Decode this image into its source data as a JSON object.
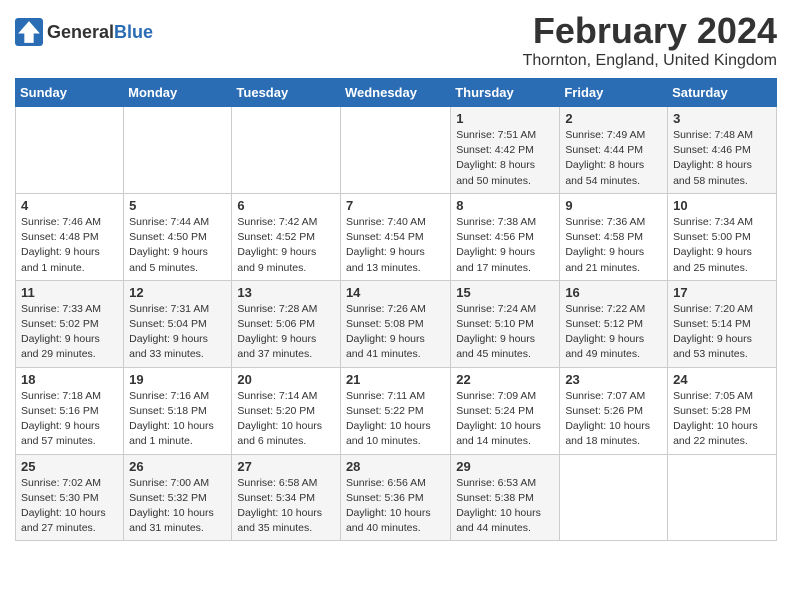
{
  "header": {
    "logo_line1": "General",
    "logo_line2": "Blue",
    "month_title": "February 2024",
    "location": "Thornton, England, United Kingdom"
  },
  "days_of_week": [
    "Sunday",
    "Monday",
    "Tuesday",
    "Wednesday",
    "Thursday",
    "Friday",
    "Saturday"
  ],
  "weeks": [
    [
      {
        "day": "",
        "info": ""
      },
      {
        "day": "",
        "info": ""
      },
      {
        "day": "",
        "info": ""
      },
      {
        "day": "",
        "info": ""
      },
      {
        "day": "1",
        "info": "Sunrise: 7:51 AM\nSunset: 4:42 PM\nDaylight: 8 hours\nand 50 minutes."
      },
      {
        "day": "2",
        "info": "Sunrise: 7:49 AM\nSunset: 4:44 PM\nDaylight: 8 hours\nand 54 minutes."
      },
      {
        "day": "3",
        "info": "Sunrise: 7:48 AM\nSunset: 4:46 PM\nDaylight: 8 hours\nand 58 minutes."
      }
    ],
    [
      {
        "day": "4",
        "info": "Sunrise: 7:46 AM\nSunset: 4:48 PM\nDaylight: 9 hours\nand 1 minute."
      },
      {
        "day": "5",
        "info": "Sunrise: 7:44 AM\nSunset: 4:50 PM\nDaylight: 9 hours\nand 5 minutes."
      },
      {
        "day": "6",
        "info": "Sunrise: 7:42 AM\nSunset: 4:52 PM\nDaylight: 9 hours\nand 9 minutes."
      },
      {
        "day": "7",
        "info": "Sunrise: 7:40 AM\nSunset: 4:54 PM\nDaylight: 9 hours\nand 13 minutes."
      },
      {
        "day": "8",
        "info": "Sunrise: 7:38 AM\nSunset: 4:56 PM\nDaylight: 9 hours\nand 17 minutes."
      },
      {
        "day": "9",
        "info": "Sunrise: 7:36 AM\nSunset: 4:58 PM\nDaylight: 9 hours\nand 21 minutes."
      },
      {
        "day": "10",
        "info": "Sunrise: 7:34 AM\nSunset: 5:00 PM\nDaylight: 9 hours\nand 25 minutes."
      }
    ],
    [
      {
        "day": "11",
        "info": "Sunrise: 7:33 AM\nSunset: 5:02 PM\nDaylight: 9 hours\nand 29 minutes."
      },
      {
        "day": "12",
        "info": "Sunrise: 7:31 AM\nSunset: 5:04 PM\nDaylight: 9 hours\nand 33 minutes."
      },
      {
        "day": "13",
        "info": "Sunrise: 7:28 AM\nSunset: 5:06 PM\nDaylight: 9 hours\nand 37 minutes."
      },
      {
        "day": "14",
        "info": "Sunrise: 7:26 AM\nSunset: 5:08 PM\nDaylight: 9 hours\nand 41 minutes."
      },
      {
        "day": "15",
        "info": "Sunrise: 7:24 AM\nSunset: 5:10 PM\nDaylight: 9 hours\nand 45 minutes."
      },
      {
        "day": "16",
        "info": "Sunrise: 7:22 AM\nSunset: 5:12 PM\nDaylight: 9 hours\nand 49 minutes."
      },
      {
        "day": "17",
        "info": "Sunrise: 7:20 AM\nSunset: 5:14 PM\nDaylight: 9 hours\nand 53 minutes."
      }
    ],
    [
      {
        "day": "18",
        "info": "Sunrise: 7:18 AM\nSunset: 5:16 PM\nDaylight: 9 hours\nand 57 minutes."
      },
      {
        "day": "19",
        "info": "Sunrise: 7:16 AM\nSunset: 5:18 PM\nDaylight: 10 hours\nand 1 minute."
      },
      {
        "day": "20",
        "info": "Sunrise: 7:14 AM\nSunset: 5:20 PM\nDaylight: 10 hours\nand 6 minutes."
      },
      {
        "day": "21",
        "info": "Sunrise: 7:11 AM\nSunset: 5:22 PM\nDaylight: 10 hours\nand 10 minutes."
      },
      {
        "day": "22",
        "info": "Sunrise: 7:09 AM\nSunset: 5:24 PM\nDaylight: 10 hours\nand 14 minutes."
      },
      {
        "day": "23",
        "info": "Sunrise: 7:07 AM\nSunset: 5:26 PM\nDaylight: 10 hours\nand 18 minutes."
      },
      {
        "day": "24",
        "info": "Sunrise: 7:05 AM\nSunset: 5:28 PM\nDaylight: 10 hours\nand 22 minutes."
      }
    ],
    [
      {
        "day": "25",
        "info": "Sunrise: 7:02 AM\nSunset: 5:30 PM\nDaylight: 10 hours\nand 27 minutes."
      },
      {
        "day": "26",
        "info": "Sunrise: 7:00 AM\nSunset: 5:32 PM\nDaylight: 10 hours\nand 31 minutes."
      },
      {
        "day": "27",
        "info": "Sunrise: 6:58 AM\nSunset: 5:34 PM\nDaylight: 10 hours\nand 35 minutes."
      },
      {
        "day": "28",
        "info": "Sunrise: 6:56 AM\nSunset: 5:36 PM\nDaylight: 10 hours\nand 40 minutes."
      },
      {
        "day": "29",
        "info": "Sunrise: 6:53 AM\nSunset: 5:38 PM\nDaylight: 10 hours\nand 44 minutes."
      },
      {
        "day": "",
        "info": ""
      },
      {
        "day": "",
        "info": ""
      }
    ]
  ]
}
